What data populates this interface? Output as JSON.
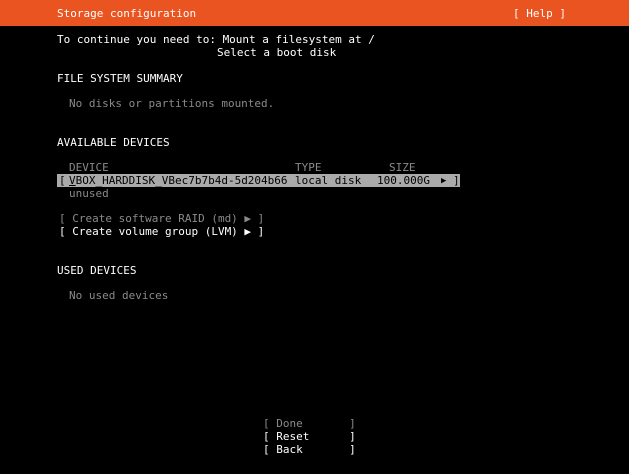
{
  "header": {
    "title": "Storage configuration",
    "help": "[ Help ]"
  },
  "instructions": {
    "line1": "To continue you need to: Mount a filesystem at /",
    "line2": "Select a boot disk"
  },
  "fs_summary": {
    "heading": "FILE SYSTEM SUMMARY",
    "message": "No disks or partitions mounted."
  },
  "available": {
    "heading": "AVAILABLE DEVICES",
    "columns": {
      "device": "DEVICE",
      "type": "TYPE",
      "size": "SIZE"
    },
    "device_row": {
      "open": "[",
      "name_first": "V",
      "name_rest": "BOX_HARDDISK_VBec7b7b4d-5d204b66",
      "type": "local disk",
      "size": "100.000G",
      "arrow": "▶",
      "close": "]"
    },
    "device_status": "unused",
    "raid_label": "[ Create software RAID (md) ▶ ]",
    "lvm_label": "[ Create volume group (LVM) ▶ ]"
  },
  "used": {
    "heading": "USED DEVICES",
    "message": "No used devices"
  },
  "buttons": {
    "done": "[ Done       ]",
    "reset": "[ Reset      ]",
    "back": "[ Back       ]"
  },
  "colors": {
    "header_bg": "#e95420",
    "background": "#000000",
    "text": "#ffffff",
    "dim_text": "#8a8a8a",
    "selection_bg": "#aaaaaa"
  }
}
